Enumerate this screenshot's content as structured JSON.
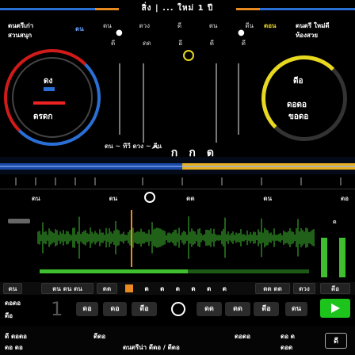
{
  "header": {
    "title": "สิ่ง | ... ใหม่ 1 ปี",
    "left_line_color": "#2a6fd6",
    "right_line_color": "#2a6fd6",
    "accent_line_color": "#e88a20"
  },
  "deck_left": {
    "line1": "ดนตรีเก่า",
    "line2": "สวนสนุก",
    "label_a": "ดน",
    "center_top": "ดง",
    "center_bottom": "ดรดก",
    "ring_color_outer": "#d11a1a",
    "ring_color_inner": "#2a6fd6"
  },
  "deck_right": {
    "line1": "ดนตรี ใหม่ดี",
    "line2": "ห้องสวย",
    "label_a": "ตอน",
    "center_top": "ดีอ",
    "center_mid": "ดอดอ",
    "center_bottom": "ขอดอ",
    "ring_color": "#e8d820"
  },
  "mixer": {
    "top_labels": [
      "ดน",
      "ดวง",
      "ดี",
      "ดน",
      "ดีน"
    ],
    "row_a": [
      "ดี",
      "ดด",
      "อี",
      "ดี",
      "ดี"
    ],
    "bottom_text": "ดน ~ ทีวี ดวง ~ ดีน",
    "center_icons": [
      "^",
      "ก",
      "ก",
      "ด"
    ]
  },
  "waveform_overview": {
    "left_color": "#2a6fd6",
    "right_color": "#e8b020"
  },
  "timeline": {
    "labels": [
      "ดน",
      "ดน",
      "ดด",
      "ดน",
      "ดอ"
    ]
  },
  "main_wave": {
    "color": "#3fbf2f",
    "marker_color": "#e88a20",
    "level_value": 0.55
  },
  "toolbar_row1": {
    "left_items": [
      "ดน",
      "ดน ดน ดน",
      "ดด"
    ],
    "center_items": [
      "ด",
      "ด",
      "ด",
      "ด",
      "ด",
      "ด",
      "ด"
    ],
    "right_items": [
      "ดด ดด",
      "ดวง",
      "ดีอ"
    ]
  },
  "toolbar_row2": {
    "left_top": "ดอดอ",
    "left_bottom": "ดีอ",
    "number": "1",
    "buttons": [
      "ดอ",
      "ดอ",
      "ดีอ",
      "ดด",
      "ดด",
      "ดีอ",
      "ดน"
    ],
    "play_color": "#1cc41c"
  },
  "footer": {
    "col1_top": "ดี ดอดอ",
    "col1_bottom": "ดอ ดอ",
    "col2_top": "ดีดอ",
    "center_text": "ดนตรีน่า ดีดอ / ดีดอ",
    "col4_top": "ดอดอ",
    "col5_top": "ดอ ด",
    "col5_bottom": "ดอด",
    "corner": "ดี"
  }
}
